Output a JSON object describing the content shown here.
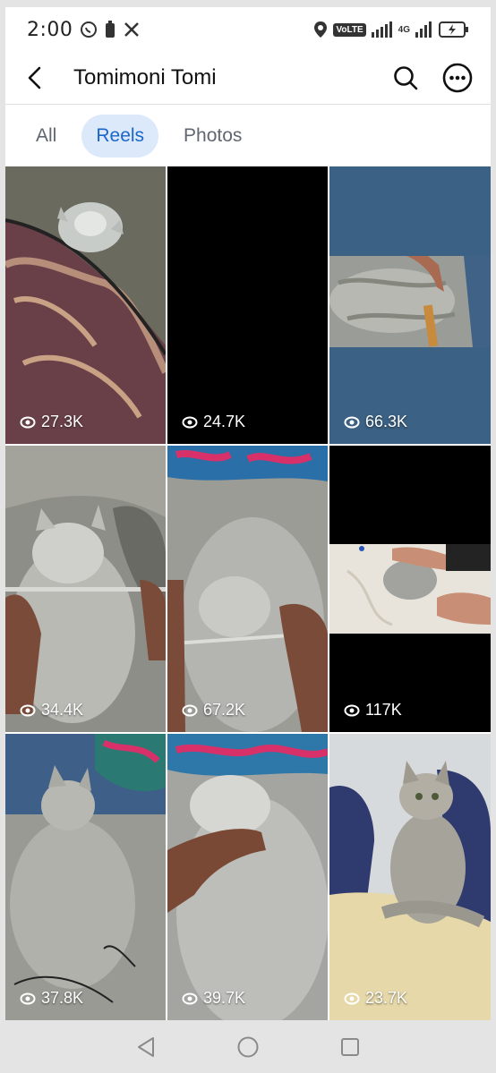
{
  "status_bar": {
    "time": "2:00",
    "network_badge": "VoLTE",
    "network_type": "4G",
    "icons": [
      "whatsapp-icon",
      "battery-saver-icon",
      "x-app-icon",
      "location-icon",
      "signal-icon",
      "battery-charging-icon"
    ]
  },
  "header": {
    "title": "Tomimoni Tomi",
    "back_icon": "back-arrow-icon",
    "search_icon": "search-icon",
    "more_icon": "more-options-icon"
  },
  "tabs": [
    {
      "label": "All",
      "active": false
    },
    {
      "label": "Reels",
      "active": true
    },
    {
      "label": "Photos",
      "active": false
    }
  ],
  "reels": [
    {
      "views": "27.3K",
      "subject": "kitten under blanket"
    },
    {
      "views": "24.7K",
      "subject": "black frame"
    },
    {
      "views": "66.3K",
      "subject": "kitten being brushed"
    },
    {
      "views": "34.4K",
      "subject": "kitten with comb"
    },
    {
      "views": "67.2K",
      "subject": "kitten lying on back"
    },
    {
      "views": "117K",
      "subject": "kitten on floor with feet"
    },
    {
      "views": "37.8K",
      "subject": "kitten on sofa"
    },
    {
      "views": "39.7K",
      "subject": "kitten chin scratch"
    },
    {
      "views": "23.7K",
      "subject": "cat sitting on lap"
    }
  ],
  "nav_bar": {
    "icons": [
      "nav-back-icon",
      "nav-home-icon",
      "nav-recents-icon"
    ]
  },
  "colors": {
    "accent": "#1b66c9",
    "tab_active_bg": "#dbe9fb",
    "tile_blue": "#3b6184",
    "tile_black": "#000000"
  }
}
